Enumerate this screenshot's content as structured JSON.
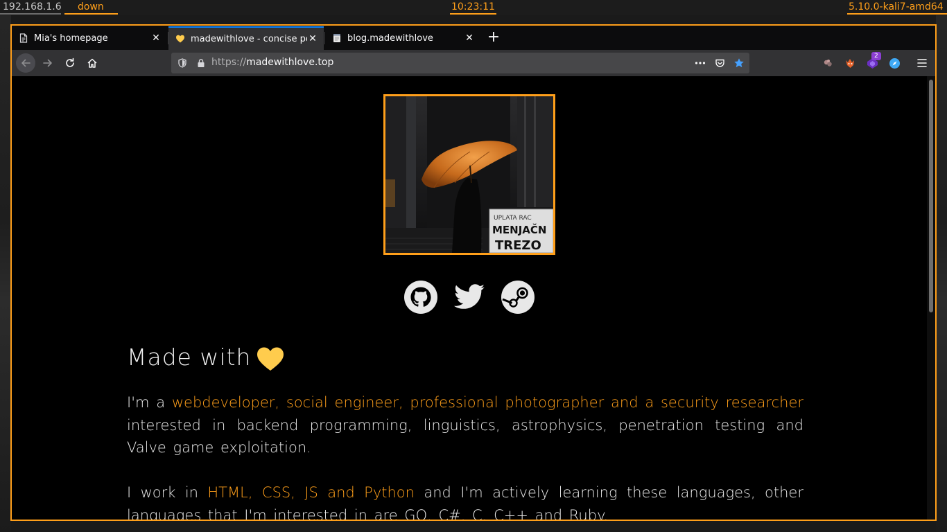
{
  "statusbar": {
    "ip": "192.168.1.6",
    "network": "down",
    "time": "10:23:11",
    "kernel": "5.10.0-kali7-amd64",
    "accent": "#ff9f1a"
  },
  "tabs": [
    {
      "title": "Mia's homepage",
      "icon": "page-icon",
      "active": false
    },
    {
      "title": "madewithlove - concise portfolio",
      "icon": "yellow-heart-icon",
      "active": true
    },
    {
      "title": "blog.madewithlove",
      "icon": "notepad-icon",
      "active": false
    }
  ],
  "urlbar": {
    "protocol": "https://",
    "domain": "madewithlove.top"
  },
  "toolbar": {
    "extension_badge": "2"
  },
  "page": {
    "heading": "Made with",
    "para1": {
      "prefix": "I'm a",
      "highlight": "webdeveloper, social engineer, professional photographer and a security researcher",
      "suffix": "interested in backend programming, linguistics, astrophysics, penetration testing and Valve game exploitation."
    },
    "para2": {
      "prefix": "I work in",
      "highlight": "HTML, CSS, JS and Python",
      "suffix": "and I'm actively learning these languages, other languages that I'm interested in are GO, C#, C, C++ and Ruby."
    },
    "photo_sign_lines": [
      "UPLATA RAC",
      "MENJAČN",
      "TREZO"
    ],
    "social": [
      "github-icon",
      "twitter-icon",
      "steam-icon"
    ],
    "accent": "#ff9f1a",
    "heart_color": "#ffcc4d"
  }
}
